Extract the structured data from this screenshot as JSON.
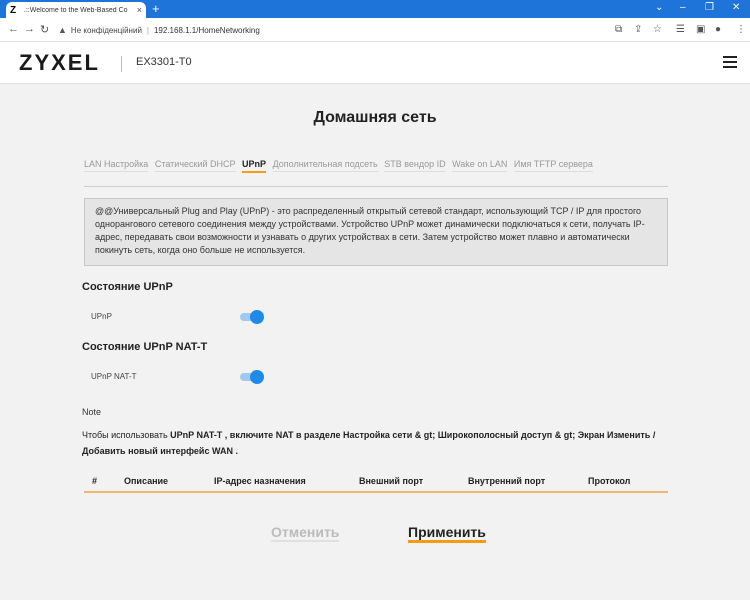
{
  "browser": {
    "tab_favicon": "Z",
    "tab_title": ".::Welcome to the Web-Based Co",
    "tab_close": "×",
    "new_tab": "+",
    "window_controls": [
      "⌄",
      "–",
      "❐",
      "✕"
    ],
    "security_warning": "Не конфіденційний",
    "url": "192.168.1.1/HomeNetworking"
  },
  "header": {
    "logo": "ZYXEL",
    "model": "EX3301-T0"
  },
  "page": {
    "title": "Домашняя сеть",
    "tabs": [
      {
        "label": "LAN Настройка"
      },
      {
        "label": "Статический DHCP"
      },
      {
        "label": "UPnP"
      },
      {
        "label": "Дополнительная подсеть"
      },
      {
        "label": "STB вендор ID"
      },
      {
        "label": "Wake on LAN"
      },
      {
        "label": "Имя TFTP сервера"
      }
    ],
    "active_tab": "UPnP",
    "info": "@@Универсальный Plug and Play (UPnP) - это распределенный открытый сетевой стандарт, использующий TCP / IP для простого одноранговогo сетевого соединения между устройствами. Устройство UPnP может динамически подключаться к сети, получать IP-адрес, передавать свои возможности и узнавать о других устройствах в сети. Затем устройство может плавно и автоматически покинуть сеть, когда оно больше не используется."
  },
  "upnp": {
    "section_title": "Состояние UPnP",
    "label": "UPnP",
    "enabled": true
  },
  "nat_t": {
    "section_title": "Состояние UPnP NAT-T",
    "label": "UPnP NAT-T",
    "enabled": true
  },
  "note": {
    "label": "Note",
    "prefix": "Чтобы использовать ",
    "bold1": "UPnP NAT-T , включите NAT в разделе Настройка сети & gt; Широкополосный доступ & gt; Экран Изменить / Добавить новый интерфейс WAN ."
  },
  "table": {
    "headers": [
      "#",
      "Описание",
      "IP-адрес назначения",
      "Внешний порт",
      "Внутренний порт",
      "Протокол"
    ]
  },
  "buttons": {
    "cancel": "Отменить",
    "apply": "Применить"
  },
  "colors": {
    "accent": "#f39c12",
    "toggle_on": "#1e8be8",
    "browser_bar": "#1e74d8"
  }
}
